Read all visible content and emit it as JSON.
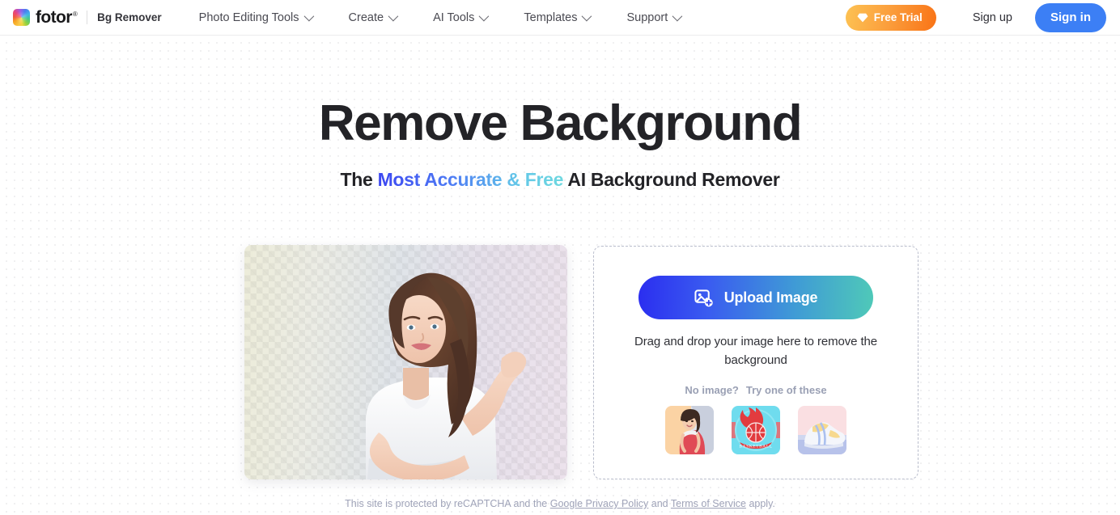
{
  "header": {
    "logo": {
      "icon_name": "fotor-rainbow-logo-icon",
      "wordmark": "fotor",
      "registered": "®"
    },
    "product_label": "Bg Remover",
    "nav": [
      {
        "label": "Photo Editing Tools",
        "icon": "chevron-down-icon"
      },
      {
        "label": "Create",
        "icon": "chevron-down-icon"
      },
      {
        "label": "AI Tools",
        "icon": "chevron-down-icon"
      },
      {
        "label": "Templates",
        "icon": "chevron-down-icon"
      },
      {
        "label": "Support",
        "icon": "chevron-down-icon"
      }
    ],
    "free_trial": {
      "label": "Free Trial",
      "icon": "diamond-gem-icon",
      "color": "#f97316"
    },
    "sign_up": "Sign up",
    "sign_in": {
      "label": "Sign in",
      "color": "#3c7ff5"
    }
  },
  "hero": {
    "title": "Remove Background",
    "subtitle_prefix": "The ",
    "subtitle_highlight": "Most Accurate & Free",
    "subtitle_suffix": " AI Background Remover",
    "highlight_gradient_from": "#3b46f1",
    "highlight_gradient_to": "#6ed8e0"
  },
  "preview": {
    "alt": "woman-with-transparent-background-preview",
    "transparency_pattern": "checkerboard"
  },
  "upload": {
    "button_label": "Upload Image",
    "button_icon": "image-plus-icon",
    "button_gradient_from": "#2b2ef0",
    "button_gradient_to": "#4fc9b8",
    "drop_text": "Drag and drop your image here to remove the background",
    "no_image_label": "No image?",
    "try_label": "Try one of these",
    "samples": [
      {
        "name": "woman-in-red-dress-thumbnail"
      },
      {
        "name": "basketball-flame-logo-thumbnail"
      },
      {
        "name": "sneaker-thumbnail"
      }
    ]
  },
  "footer": {
    "text_before": "This site is protected by reCAPTCHA and the ",
    "link_privacy": "Google Privacy Policy",
    "text_middle": " and ",
    "link_terms": "Terms of Service",
    "text_after": " apply."
  }
}
